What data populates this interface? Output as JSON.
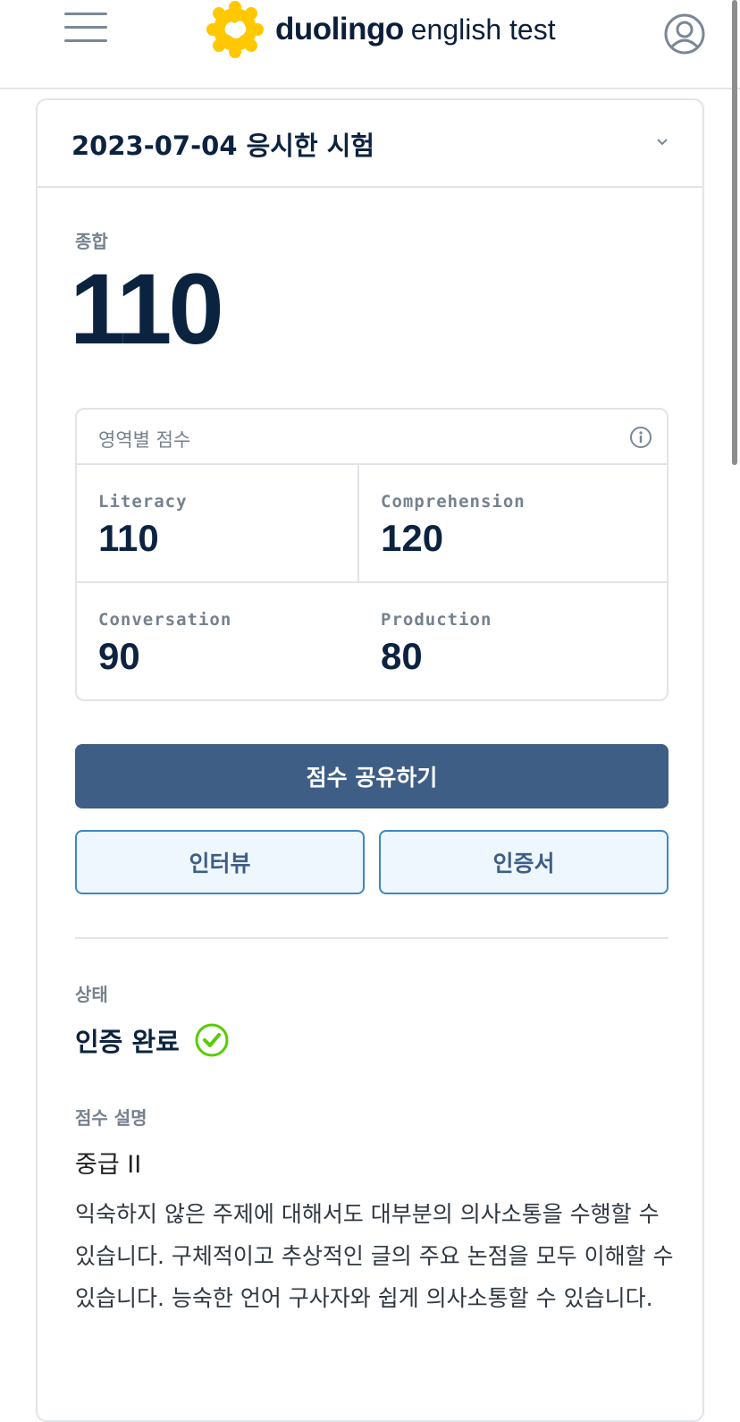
{
  "header": {
    "brand_name": "duolingo",
    "brand_sub": "english test"
  },
  "exam": {
    "title": "2023-07-04 응시한 시험"
  },
  "overall": {
    "label": "종합",
    "score": "110"
  },
  "subscores": {
    "heading": "영역별 점수",
    "items": [
      {
        "label": "Literacy",
        "value": "110"
      },
      {
        "label": "Comprehension",
        "value": "120"
      },
      {
        "label": "Conversation",
        "value": "90"
      },
      {
        "label": "Production",
        "value": "80"
      }
    ]
  },
  "actions": {
    "share_label": "점수 공유하기",
    "interview_label": "인터뷰",
    "certificate_label": "인증서"
  },
  "status": {
    "label": "상태",
    "value": "인증 완료"
  },
  "description": {
    "label": "점수 설명",
    "level": "중급 II",
    "text": "익숙하지 않은 주제에 대해서도 대부분의 의사소통을 수행할 수 있습니다. 구체적이고 추상적인 글의 주요 논점을 모두 이해할 수 있습니다. 능숙한 언어 구사자와 쉽게 의사소통할 수 있습니다."
  },
  "colors": {
    "primary_button": "#3e5e86",
    "secondary_border": "#3b88c6",
    "brand_yellow": "#ffc800",
    "check_green": "#58cc02",
    "text_dark": "#0c2340"
  }
}
